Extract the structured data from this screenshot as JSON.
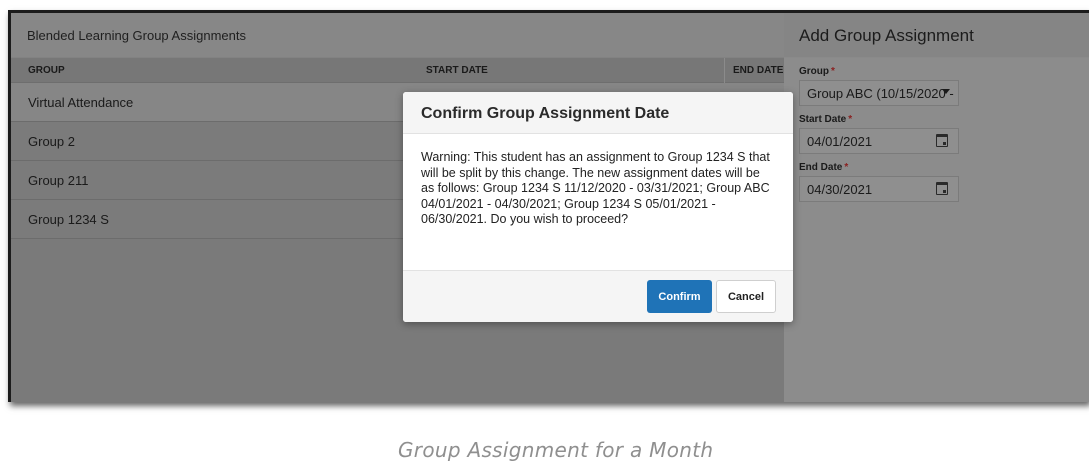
{
  "list_panel": {
    "title": "Blended Learning Group Assignments",
    "columns": {
      "group": "GROUP",
      "start_date": "START DATE",
      "end_date": "END DATE"
    },
    "rows": [
      "Virtual Attendance",
      "Group 2",
      "Group 211",
      "Group 1234 S"
    ]
  },
  "add_panel": {
    "title": "Add Group Assignment",
    "group_label": "Group",
    "group_value": "Group ABC (10/15/2020 -",
    "start_label": "Start Date",
    "start_value": "04/01/2021",
    "end_label": "End Date",
    "end_value": "04/30/2021",
    "required_mark": "*"
  },
  "modal": {
    "title": "Confirm Group Assignment Date",
    "body": "Warning: This student has an assignment to Group 1234 S that will be split by this change. The new assignment dates will be as follows: Group 1234 S 11/12/2020 - 03/31/2021; Group ABC 04/01/2021 - 04/30/2021; Group 1234 S 05/01/2021 - 06/30/2021. Do you wish to proceed?",
    "confirm_label": "Confirm",
    "cancel_label": "Cancel"
  },
  "caption": "Group Assignment for a Month",
  "colors": {
    "primary_button": "#1f73b7",
    "overlay": "#7a7a7a",
    "required": "#8a1f1f"
  }
}
